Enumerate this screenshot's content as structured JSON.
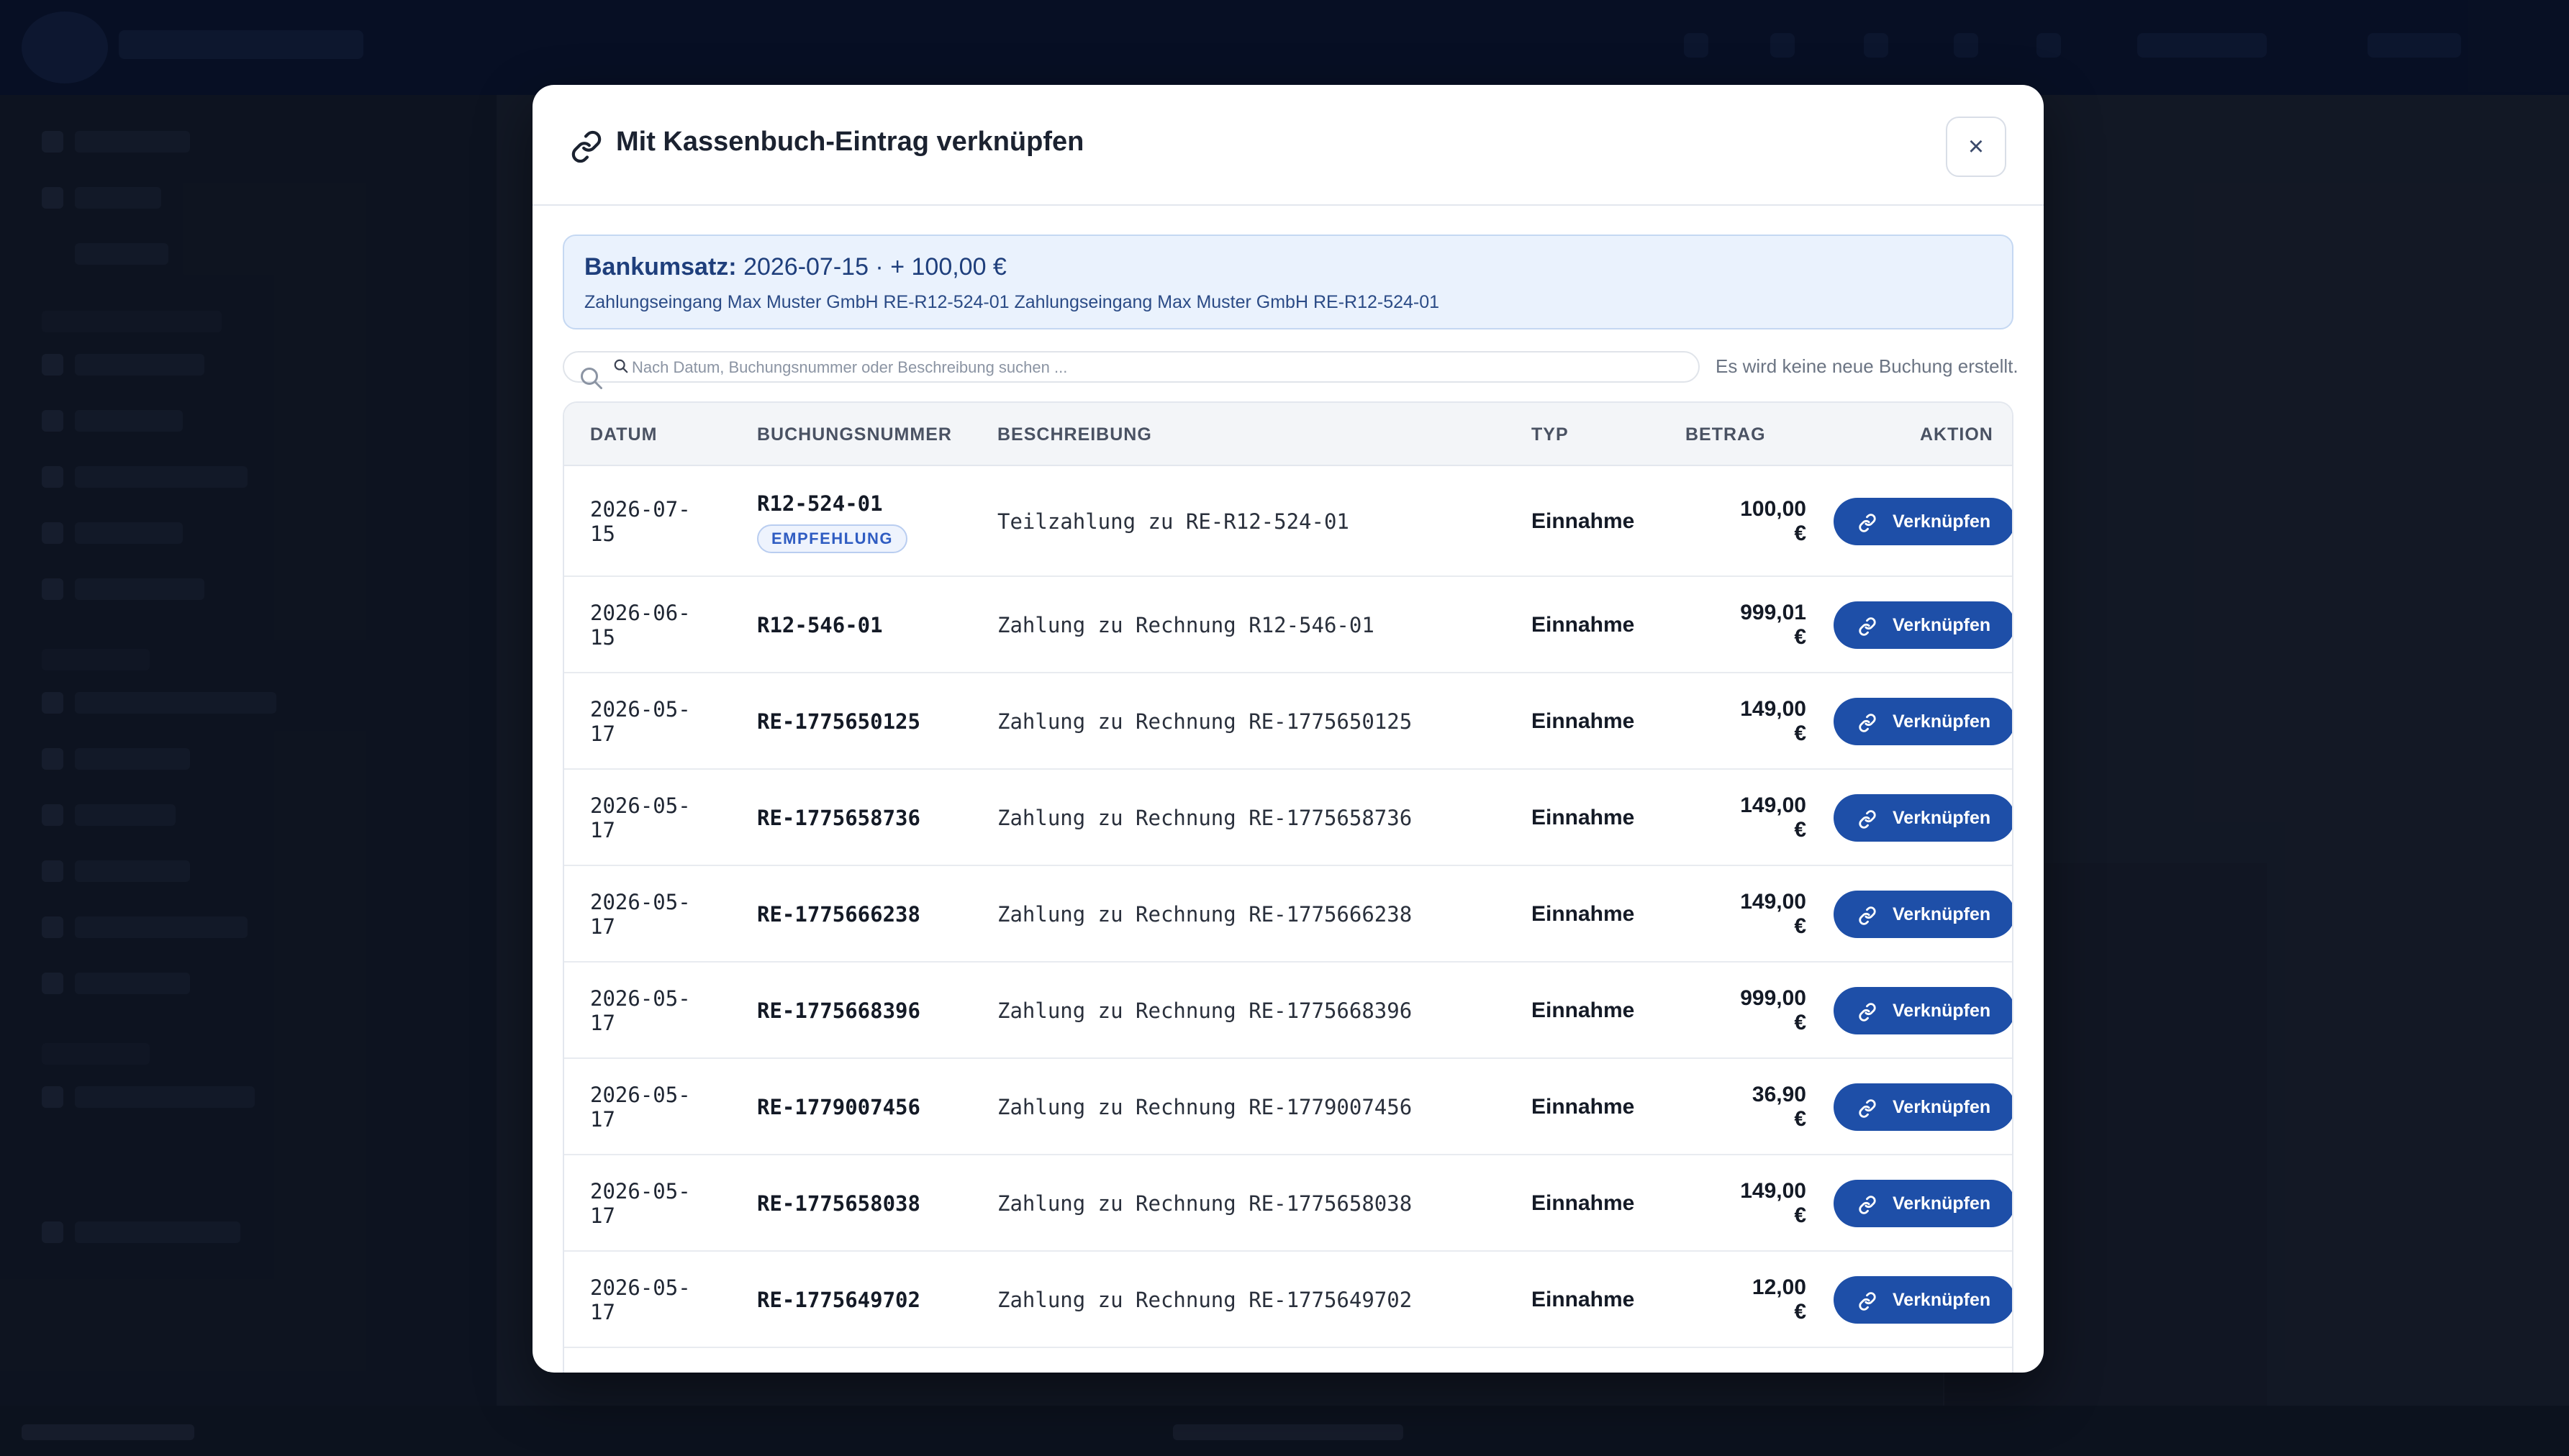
{
  "modal": {
    "title": "Mit Kassenbuch-Eintrag verknüpfen",
    "close_label": "×",
    "bank": {
      "label": "Bankumsatz:",
      "summary": "2026-07-15 · + 100,00 €",
      "detail": "Zahlungseingang Max Muster GmbH RE-R12-524-01 Zahlungseingang Max Muster GmbH RE-R12-524-01"
    },
    "search": {
      "placeholder": "Nach Datum, Buchungsnummer oder Beschreibung suchen ...",
      "value": ""
    },
    "hint": "Es wird keine neue Buchung erstellt.",
    "columns": {
      "date": "DATUM",
      "number": "BUCHUNGSNUMMER",
      "description": "BESCHREIBUNG",
      "type": "TYP",
      "amount": "BETRAG",
      "action": "AKTION"
    },
    "recommend_badge": "EMPFEHLUNG",
    "button_label": "Verknüpfen",
    "rows": [
      {
        "date_a": "2026-07-",
        "date_b": "15",
        "number": "R12-524-01",
        "recommended": true,
        "description": "Teilzahlung zu RE-R12-524-01",
        "type": "Einnahme",
        "amount_a": "100,00",
        "amount_b": "€"
      },
      {
        "date_a": "2026-06-",
        "date_b": "15",
        "number": "R12-546-01",
        "recommended": false,
        "description": "Zahlung zu Rechnung R12-546-01",
        "type": "Einnahme",
        "amount_a": "999,01",
        "amount_b": "€"
      },
      {
        "date_a": "2026-05-",
        "date_b": "17",
        "number": "RE-1775650125",
        "recommended": false,
        "description": "Zahlung zu Rechnung RE-1775650125",
        "type": "Einnahme",
        "amount_a": "149,00",
        "amount_b": "€"
      },
      {
        "date_a": "2026-05-",
        "date_b": "17",
        "number": "RE-1775658736",
        "recommended": false,
        "description": "Zahlung zu Rechnung RE-1775658736",
        "type": "Einnahme",
        "amount_a": "149,00",
        "amount_b": "€"
      },
      {
        "date_a": "2026-05-",
        "date_b": "17",
        "number": "RE-1775666238",
        "recommended": false,
        "description": "Zahlung zu Rechnung RE-1775666238",
        "type": "Einnahme",
        "amount_a": "149,00",
        "amount_b": "€"
      },
      {
        "date_a": "2026-05-",
        "date_b": "17",
        "number": "RE-1775668396",
        "recommended": false,
        "description": "Zahlung zu Rechnung RE-1775668396",
        "type": "Einnahme",
        "amount_a": "999,00",
        "amount_b": "€"
      },
      {
        "date_a": "2026-05-",
        "date_b": "17",
        "number": "RE-1779007456",
        "recommended": false,
        "description": "Zahlung zu Rechnung RE-1779007456",
        "type": "Einnahme",
        "amount_a": "36,90",
        "amount_b": "€"
      },
      {
        "date_a": "2026-05-",
        "date_b": "17",
        "number": "RE-1775658038",
        "recommended": false,
        "description": "Zahlung zu Rechnung RE-1775658038",
        "type": "Einnahme",
        "amount_a": "149,00",
        "amount_b": "€"
      },
      {
        "date_a": "2026-05-",
        "date_b": "17",
        "number": "RE-1775649702",
        "recommended": false,
        "description": "Zahlung zu Rechnung RE-1775649702",
        "type": "Einnahme",
        "amount_a": "12,00",
        "amount_b": "€"
      }
    ]
  },
  "colors": {
    "primary_button": "#1e4fa8",
    "info_bg": "#eaf2fd",
    "badge_text": "#2f5cc2",
    "topbar": "#0a1838"
  },
  "icons": {
    "title": "link-icon",
    "close": "close-icon",
    "search": "search-icon",
    "button": "link-icon"
  }
}
